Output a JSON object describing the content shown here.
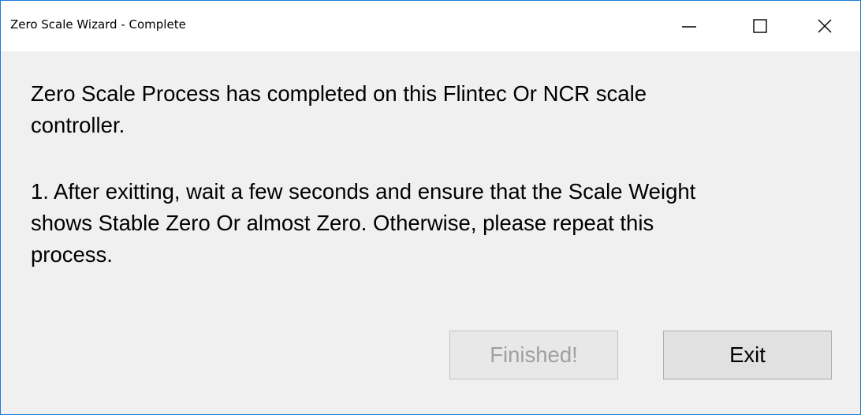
{
  "window": {
    "title": "Zero Scale Wizard - Complete",
    "accent_color": "#1a7bd4",
    "controls": {
      "minimize_icon": "minimize-icon",
      "maximize_icon": "maximize-icon",
      "close_icon": "close-icon"
    }
  },
  "dialog": {
    "message_1": "Zero Scale Process has completed on this Flintec Or NCR scale\ncontroller.",
    "message_2": "1. After exitting, wait a few seconds and ensure that the Scale Weight\nshows Stable Zero Or almost Zero.  Otherwise, please repeat this\nprocess."
  },
  "buttons": {
    "finished_label": "Finished!",
    "finished_enabled": false,
    "exit_label": "Exit"
  }
}
